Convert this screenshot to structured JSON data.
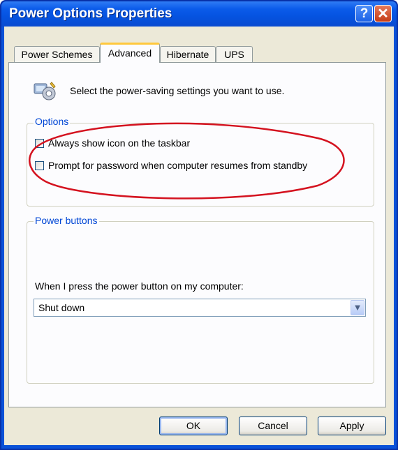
{
  "window": {
    "title": "Power Options Properties",
    "help_glyph": "?",
    "close_glyph": "✕"
  },
  "tabs": [
    {
      "label": "Power Schemes",
      "active": false
    },
    {
      "label": "Advanced",
      "active": true
    },
    {
      "label": "Hibernate",
      "active": false
    },
    {
      "label": "UPS",
      "active": false
    }
  ],
  "intro": {
    "text": "Select the power-saving settings you want to use.",
    "icon": "power-settings-icon"
  },
  "options": {
    "legend": "Options",
    "items": [
      {
        "label": "Always show icon on the taskbar",
        "checked": false
      },
      {
        "label": "Prompt for password when computer resumes from standby",
        "checked": false
      }
    ]
  },
  "power_buttons": {
    "legend": "Power buttons",
    "prompt": "When I press the power button on my computer:",
    "selected": "Shut down"
  },
  "buttons": {
    "ok": "OK",
    "cancel": "Cancel",
    "apply": "Apply"
  },
  "colors": {
    "titlebar": "#0553e0",
    "annotation": "#d4121f",
    "group_label": "#0046d5",
    "active_tab_accent": "#ffc83c"
  }
}
